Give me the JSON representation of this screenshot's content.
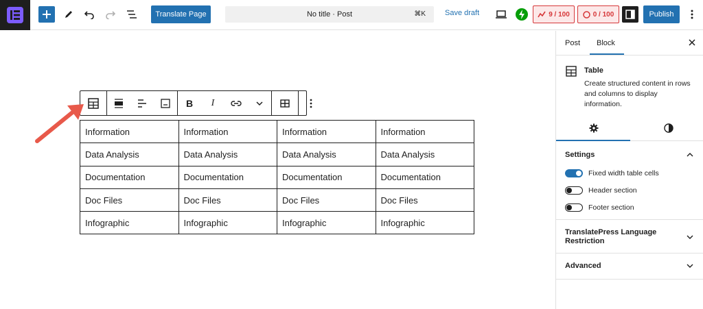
{
  "topbar": {
    "translate_label": "Translate Page",
    "command_title": "No title · Post",
    "command_shortcut": "⌘K",
    "save_draft": "Save draft",
    "score1": "9 / 100",
    "score2": "0 / 100",
    "publish": "Publish"
  },
  "table": {
    "rows": [
      [
        "Information",
        "Information",
        "Information",
        "Information"
      ],
      [
        "Data Analysis",
        "Data Analysis",
        "Data Analysis",
        "Data Analysis"
      ],
      [
        "Documentation",
        "Documentation",
        "Documentation",
        "Documentation"
      ],
      [
        "Doc Files",
        "Doc Files",
        "Doc Files",
        "Doc Files"
      ],
      [
        "Infographic",
        "Infographic",
        "Infographic",
        "Infographic"
      ]
    ]
  },
  "panel": {
    "tab_post": "Post",
    "tab_block": "Block",
    "block_title": "Table",
    "block_desc": "Create structured content in rows and columns to display information.",
    "settings_title": "Settings",
    "toggles": [
      {
        "label": "Fixed width table cells",
        "on": true
      },
      {
        "label": "Header section",
        "on": false
      },
      {
        "label": "Footer section",
        "on": false
      }
    ],
    "translatepress_title": "TranslatePress Language Restriction",
    "advanced_title": "Advanced"
  },
  "colors": {
    "accent": "#2271b1",
    "arrow": "#e8594a",
    "score": "#d63638"
  }
}
